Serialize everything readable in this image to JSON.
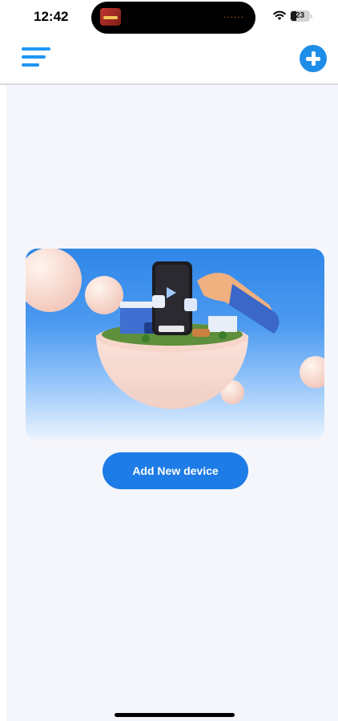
{
  "status_bar": {
    "time": "12:42",
    "battery": "23",
    "island_dots": "······"
  },
  "colors": {
    "accent": "#1e7ce6",
    "menu_icon": "#2196f3",
    "background": "#f5f6fb"
  },
  "icons": {
    "menu": "hamburger-menu-icon",
    "add": "plus-circle-icon",
    "wifi": "wifi-icon",
    "battery": "battery-icon"
  },
  "main": {
    "add_device_label": "Add New device"
  }
}
